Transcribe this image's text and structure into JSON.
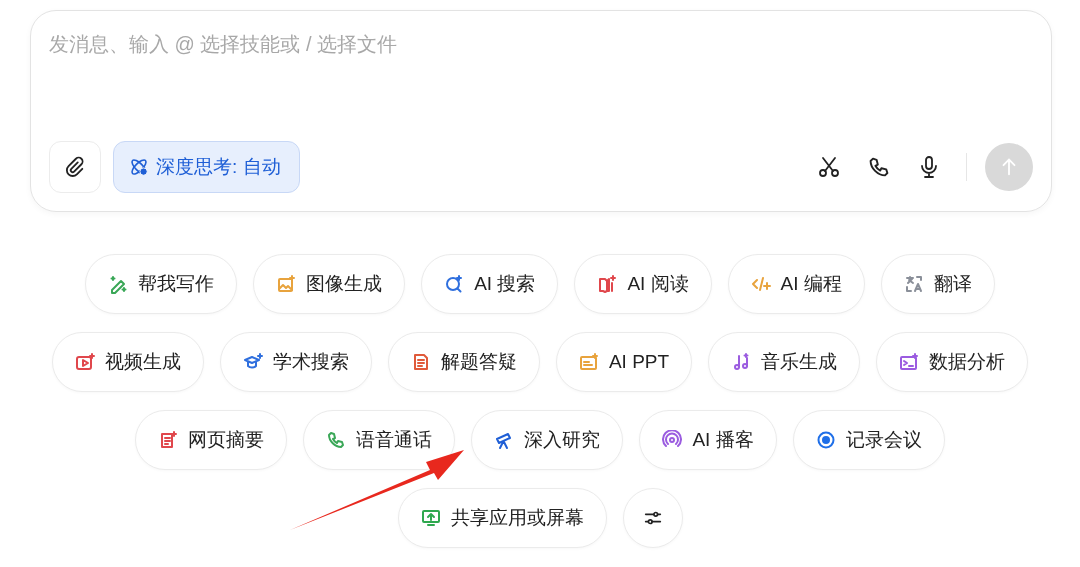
{
  "input": {
    "placeholder": "发消息、输入 @ 选择技能或 / 选择文件"
  },
  "deep_think": {
    "label": "深度思考: 自动",
    "selected": true
  },
  "chip_rows": [
    [
      {
        "label": "帮我写作",
        "color": "#3aa757"
      },
      {
        "label": "图像生成",
        "color": "#e8a33d"
      },
      {
        "label": "AI 搜索",
        "color": "#2f6fde"
      },
      {
        "label": "AI 阅读",
        "color": "#e0474c"
      },
      {
        "label": "AI 编程",
        "color": "#e8a33d"
      },
      {
        "label": "翻译",
        "color": "#8a8f99"
      }
    ],
    [
      {
        "label": "视频生成",
        "color": "#e0474c"
      },
      {
        "label": "学术搜索",
        "color": "#2f6fde"
      },
      {
        "label": "解题答疑",
        "color": "#e05a3a"
      },
      {
        "label": "AI PPT",
        "color": "#e8a33d"
      },
      {
        "label": "音乐生成",
        "color": "#9b5ce0"
      },
      {
        "label": "数据分析",
        "color": "#9b5ce0"
      }
    ],
    [
      {
        "label": "网页摘要",
        "color": "#e0474c"
      },
      {
        "label": "语音通话",
        "color": "#3aa757"
      },
      {
        "label": "深入研究",
        "color": "#1f5fd6"
      },
      {
        "label": "AI 播客",
        "color": "#9b5ce0"
      },
      {
        "label": "记录会议",
        "color": "#1f6fe8"
      }
    ],
    [
      {
        "label": "共享应用或屏幕",
        "color": "#2fa84f"
      }
    ]
  ]
}
